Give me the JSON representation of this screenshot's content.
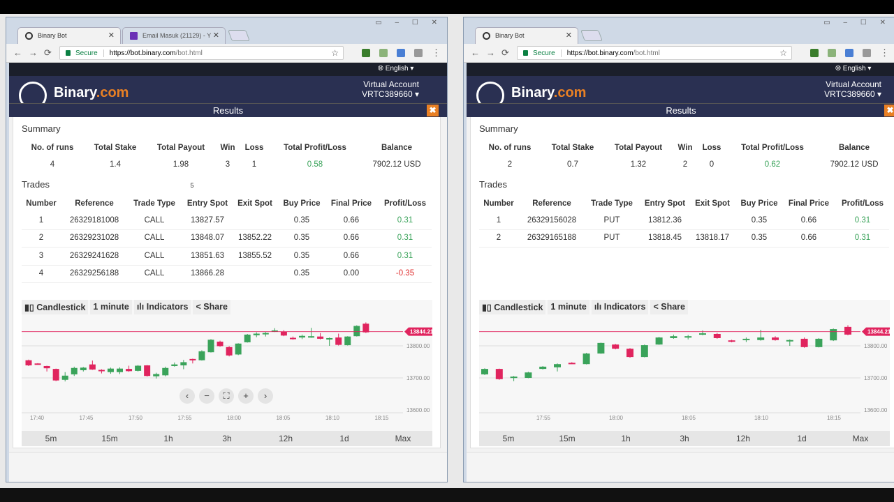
{
  "colors": {
    "brand_navy": "#2a3052",
    "brand_orange": "#e98024",
    "candle_up": "#3aa35a",
    "candle_down": "#e0245e",
    "profit": "#3aa35a",
    "loss": "#e03131"
  },
  "windows": [
    {
      "tabs": [
        {
          "label": "Binary Bot",
          "icon": "binary-favicon"
        },
        {
          "label": "Email Masuk (21129) - Y",
          "icon": "yahoo-mail-icon"
        }
      ],
      "url": {
        "secure_label": "Secure",
        "host": "https://bot.binary.com",
        "path": "/bot.html"
      },
      "language": "English",
      "logo": {
        "name": "Binary",
        ".com": ".com",
        "dot_com": ".com"
      },
      "account": {
        "type": "Virtual Account",
        "id": "VRTC389660"
      },
      "results_title": "Results",
      "summary": {
        "title": "Summary",
        "headers": [
          "No. of runs",
          "Total Stake",
          "Total Payout",
          "Win",
          "Loss",
          "Total Profit/Loss",
          "Balance"
        ],
        "values": [
          "4",
          "1.4",
          "1.98",
          "3",
          "1",
          "0.58",
          "7902.12 USD"
        ]
      },
      "trades_title": "Trades",
      "trades_badge": "5",
      "trades": {
        "headers": [
          "Number",
          "Reference",
          "Trade Type",
          "Entry Spot",
          "Exit Spot",
          "Buy Price",
          "Final Price",
          "Profit/Loss"
        ],
        "rows": [
          [
            "1",
            "26329181008",
            "CALL",
            "13827.57",
            "",
            "0.35",
            "0.66",
            "0.31"
          ],
          [
            "2",
            "26329231028",
            "CALL",
            "13848.07",
            "13852.22",
            "0.35",
            "0.66",
            "0.31"
          ],
          [
            "3",
            "26329241628",
            "CALL",
            "13851.63",
            "13855.52",
            "0.35",
            "0.66",
            "0.31"
          ],
          [
            "4",
            "26329256188",
            "CALL",
            "13866.28",
            "",
            "0.35",
            "0.00",
            "-0.35"
          ]
        ]
      },
      "chart_toolbar": {
        "type": "Candlestick",
        "interval": "1 minute",
        "indicators": "Indicators",
        "share": "Share"
      },
      "ranges": [
        "5m",
        "15m",
        "1h",
        "3h",
        "12h",
        "1d",
        "Max"
      ],
      "chart_data": {
        "type": "candlestick",
        "current_price": "13844.21",
        "y_ticks": [
          "13800.00",
          "13700.00",
          "13600.00"
        ],
        "ylim": [
          13580,
          13880
        ],
        "x_ticks": [
          "17:40",
          "17:45",
          "17:50",
          "17:55",
          "18:00",
          "18:05",
          "18:10",
          "18:15"
        ],
        "candles": [
          [
            13755,
            13739,
            13757,
            13737
          ],
          [
            13745,
            13742,
            13746,
            13741
          ],
          [
            13737,
            13730,
            13738,
            13720
          ],
          [
            13728,
            13692,
            13729,
            13690
          ],
          [
            13694,
            13707,
            13718,
            13689
          ],
          [
            13711,
            13731,
            13735,
            13706
          ],
          [
            13724,
            13732,
            13734,
            13720
          ],
          [
            13742,
            13726,
            13754,
            13725
          ],
          [
            13725,
            13721,
            13727,
            13714
          ],
          [
            13718,
            13729,
            13732,
            13713
          ],
          [
            13718,
            13729,
            13733,
            13712
          ],
          [
            13728,
            13721,
            13738,
            13719
          ],
          [
            13722,
            13738,
            13740,
            13720
          ],
          [
            13739,
            13706,
            13740,
            13704
          ],
          [
            13705,
            13712,
            13716,
            13698
          ],
          [
            13708,
            13731,
            13735,
            13705
          ],
          [
            13737,
            13742,
            13748,
            13735
          ],
          [
            13739,
            13749,
            13756,
            13727
          ],
          [
            13759,
            13755,
            13760,
            13745
          ],
          [
            13755,
            13783,
            13786,
            13754
          ],
          [
            13780,
            13819,
            13821,
            13779
          ],
          [
            13813,
            13799,
            13816,
            13797
          ],
          [
            13796,
            13770,
            13799,
            13767
          ],
          [
            13773,
            13807,
            13808,
            13771
          ],
          [
            13811,
            13835,
            13837,
            13810
          ],
          [
            13833,
            13838,
            13842,
            13827
          ],
          [
            13838,
            13840,
            13843,
            13829
          ],
          [
            13845,
            13848,
            13855,
            13843
          ],
          [
            13844,
            13832,
            13849,
            13830
          ],
          [
            13825,
            13823,
            13829,
            13819
          ],
          [
            13826,
            13831,
            13835,
            13821
          ],
          [
            13827,
            13830,
            13856,
            13825
          ],
          [
            13829,
            13822,
            13840,
            13820
          ],
          [
            13822,
            13824,
            13826,
            13800
          ],
          [
            13826,
            13803,
            13838,
            13801
          ],
          [
            13802,
            13829,
            13830,
            13801
          ],
          [
            13830,
            13862,
            13864,
            13829
          ],
          [
            13869,
            13842,
            13873,
            13840
          ]
        ]
      }
    },
    {
      "tabs": [
        {
          "label": "Binary Bot",
          "icon": "binary-favicon"
        }
      ],
      "url": {
        "secure_label": "Secure",
        "host": "https://bot.binary.com",
        "path": "/bot.html"
      },
      "language": "English",
      "logo": {
        "name": "Binary",
        "dot_com": ".com"
      },
      "account": {
        "type": "Virtual Account",
        "id": "VRTC389660"
      },
      "results_title": "Results",
      "summary": {
        "title": "Summary",
        "headers": [
          "No. of runs",
          "Total Stake",
          "Total Payout",
          "Win",
          "Loss",
          "Total Profit/Loss",
          "Balance"
        ],
        "values": [
          "2",
          "0.7",
          "1.32",
          "2",
          "0",
          "0.62",
          "7902.12 USD"
        ]
      },
      "trades_title": "Trades",
      "trades": {
        "headers": [
          "Number",
          "Reference",
          "Trade Type",
          "Entry Spot",
          "Exit Spot",
          "Buy Price",
          "Final Price",
          "Profit/Loss"
        ],
        "rows": [
          [
            "1",
            "26329156028",
            "PUT",
            "13812.36",
            "",
            "0.35",
            "0.66",
            "0.31"
          ],
          [
            "2",
            "26329165188",
            "PUT",
            "13818.45",
            "13818.17",
            "0.35",
            "0.66",
            "0.31"
          ]
        ]
      },
      "chart_toolbar": {
        "type": "Candlestick",
        "interval": "1 minute",
        "indicators": "Indicators",
        "share": "Share"
      },
      "ranges": [
        "5m",
        "15m",
        "1h",
        "3h",
        "12h",
        "1d",
        "Max"
      ],
      "chart_data": {
        "type": "candlestick",
        "current_price": "13844.21",
        "y_ticks": [
          "13800.00",
          "13700.00",
          "13600.00"
        ],
        "ylim": [
          13580,
          13880
        ],
        "x_ticks": [
          "17:55",
          "18:00",
          "18:05",
          "18:10",
          "18:15"
        ],
        "candles": [
          [
            13711,
            13728,
            13730,
            13709
          ],
          [
            13728,
            13696,
            13729,
            13694
          ],
          [
            13700,
            13704,
            13706,
            13690
          ],
          [
            13700,
            13717,
            13719,
            13699
          ],
          [
            13728,
            13735,
            13737,
            13726
          ],
          [
            13733,
            13743,
            13745,
            13720
          ],
          [
            13747,
            13745,
            13749,
            13744
          ],
          [
            13743,
            13776,
            13778,
            13742
          ],
          [
            13776,
            13809,
            13810,
            13775
          ],
          [
            13804,
            13791,
            13806,
            13789
          ],
          [
            13791,
            13765,
            13793,
            13763
          ],
          [
            13765,
            13802,
            13804,
            13764
          ],
          [
            13804,
            13826,
            13828,
            13803
          ],
          [
            13824,
            13830,
            13835,
            13822
          ],
          [
            13826,
            13830,
            13834,
            13820
          ],
          [
            13835,
            13839,
            13848,
            13833
          ],
          [
            13837,
            13824,
            13840,
            13822
          ],
          [
            13817,
            13813,
            13819,
            13811
          ],
          [
            13818,
            13822,
            13826,
            13812
          ],
          [
            13818,
            13826,
            13850,
            13816
          ],
          [
            13826,
            13818,
            13830,
            13816
          ],
          [
            13814,
            13818,
            13820,
            13800
          ],
          [
            13822,
            13796,
            13826,
            13794
          ],
          [
            13796,
            13822,
            13824,
            13795
          ],
          [
            13817,
            13852,
            13854,
            13815
          ],
          [
            13859,
            13835,
            13864,
            13833
          ]
        ]
      }
    }
  ]
}
